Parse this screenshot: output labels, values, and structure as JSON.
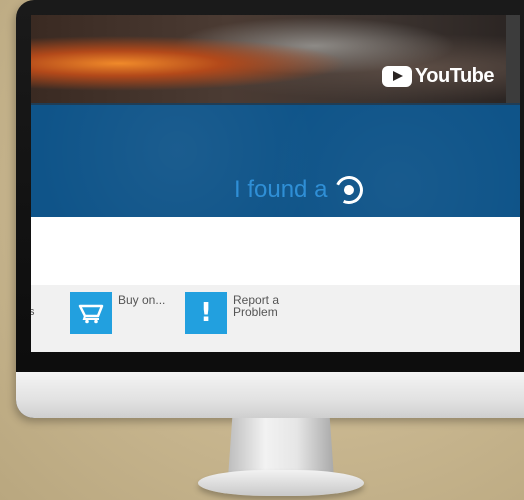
{
  "video": {
    "brand": "YouTube"
  },
  "banner": {
    "headline": "I found a"
  },
  "actions": {
    "fragment_text": "s",
    "buy": {
      "label": "Buy on..."
    },
    "report": {
      "label": "Report a\nProblem"
    }
  },
  "icons": {
    "youtube_logo": "youtube-play-icon",
    "found": "circle-target-icon",
    "buy": "shopping-cart-icon",
    "report": "exclamation-icon"
  },
  "colors": {
    "banner_bg": "#0f5489",
    "headline_text": "#2f8fd6",
    "action_icon_bg": "#22a0df",
    "bottom_bar_bg": "#f1f1f1"
  }
}
